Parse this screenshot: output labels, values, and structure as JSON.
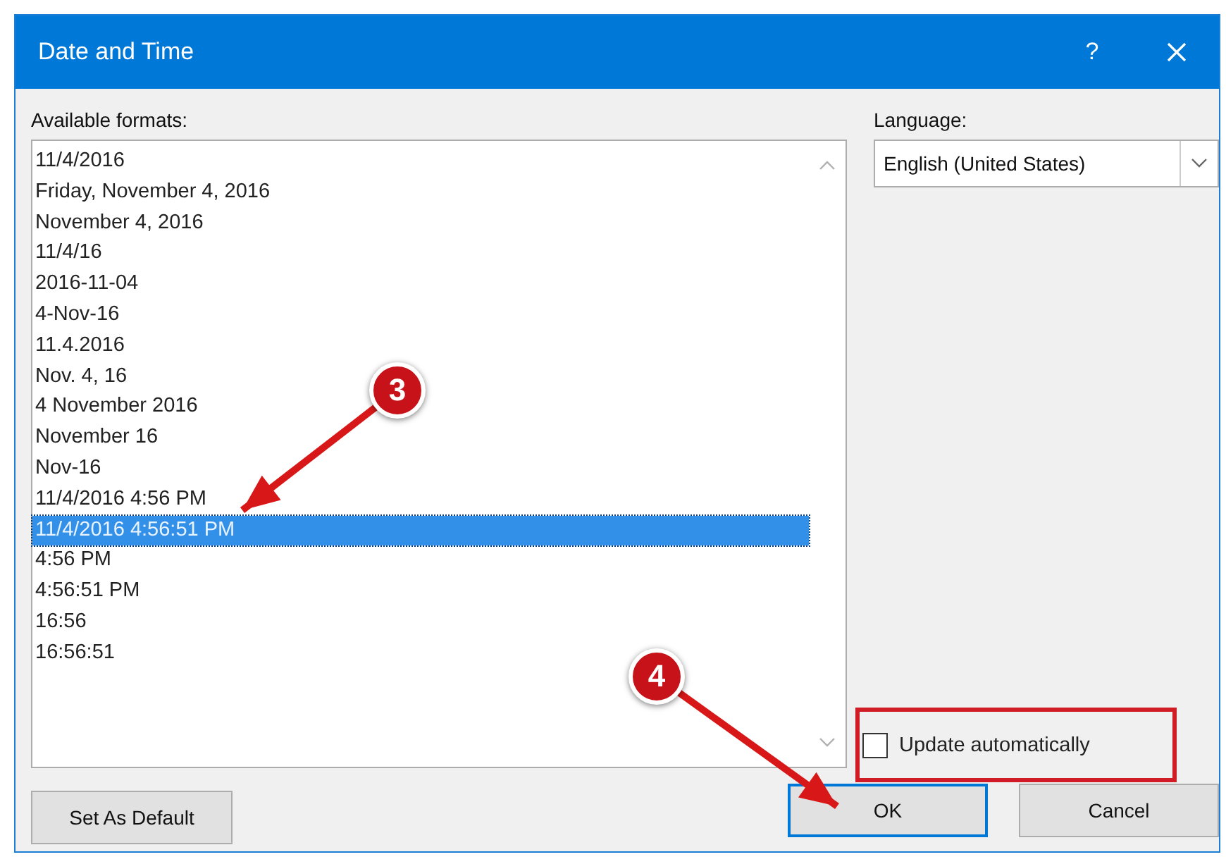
{
  "window": {
    "title": "Date and Time",
    "help": "?"
  },
  "formats": {
    "label": "Available formats:",
    "items": [
      {
        "text": "11/4/2016",
        "selected": false
      },
      {
        "text": "Friday, November 4, 2016",
        "selected": false
      },
      {
        "text": "November 4, 2016",
        "selected": false
      },
      {
        "text": "11/4/16",
        "selected": false
      },
      {
        "text": "2016-11-04",
        "selected": false
      },
      {
        "text": "4-Nov-16",
        "selected": false
      },
      {
        "text": "11.4.2016",
        "selected": false
      },
      {
        "text": "Nov. 4, 16",
        "selected": false
      },
      {
        "text": "4 November 2016",
        "selected": false
      },
      {
        "text": "November 16",
        "selected": false
      },
      {
        "text": "Nov-16",
        "selected": false
      },
      {
        "text": "11/4/2016 4:56 PM",
        "selected": false
      },
      {
        "text": "11/4/2016 4:56:51 PM",
        "selected": true
      },
      {
        "text": "4:56 PM",
        "selected": false
      },
      {
        "text": "4:56:51 PM",
        "selected": false
      },
      {
        "text": "16:56",
        "selected": false
      },
      {
        "text": "16:56:51",
        "selected": false
      }
    ]
  },
  "language": {
    "label": "Language:",
    "value": "English (United States)"
  },
  "update_automatically": {
    "label": "Update automatically",
    "checked": false
  },
  "buttons": [
    {
      "label": "Set As Default",
      "default": false
    },
    {
      "label": "OK",
      "default": true
    },
    {
      "label": "Cancel",
      "default": false
    }
  ],
  "annotations": [
    {
      "kind": "step",
      "label": "3"
    },
    {
      "kind": "step",
      "label": "4"
    },
    {
      "kind": "box"
    }
  ]
}
